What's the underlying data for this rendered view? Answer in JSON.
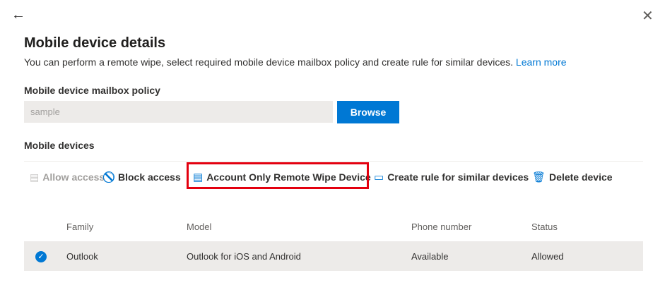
{
  "header": {
    "title": "Mobile device details",
    "description": "You can perform a remote wipe, select required mobile device mailbox policy and create rule for similar devices.",
    "learn_more": "Learn more"
  },
  "policy": {
    "label": "Mobile device mailbox policy",
    "value": "sample",
    "browse": "Browse"
  },
  "devices": {
    "label": "Mobile devices",
    "toolbar": {
      "allow": "Allow access",
      "block": "Block access",
      "wipe": "Account Only Remote Wipe Device",
      "create_rule": "Create rule for similar devices",
      "delete": "Delete device"
    },
    "columns": [
      "Family",
      "Model",
      "Phone number",
      "Status"
    ],
    "rows": [
      {
        "family": "Outlook",
        "model": "Outlook for iOS and Android",
        "phone": "Available",
        "status": "Allowed",
        "selected": true
      }
    ]
  },
  "colors": {
    "accent": "#0078d4",
    "highlight": "#e3000f"
  }
}
